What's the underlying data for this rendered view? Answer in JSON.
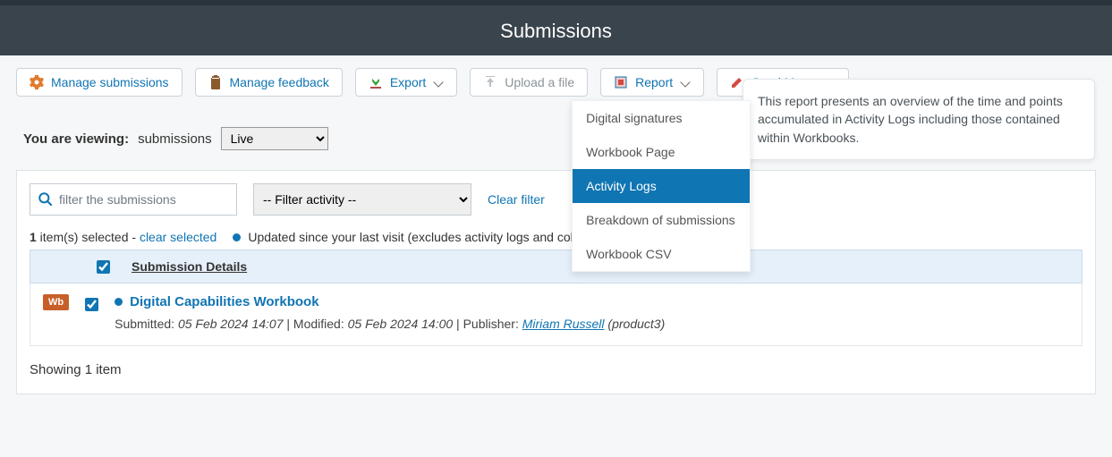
{
  "header": {
    "title": "Submissions"
  },
  "toolbar": {
    "manage_submissions": "Manage submissions",
    "manage_feedback": "Manage feedback",
    "export": "Export",
    "upload": "Upload a file",
    "report": "Report",
    "send_message": "Send Message"
  },
  "report_menu": {
    "digital_signatures": "Digital signatures",
    "workbook_page": "Workbook Page",
    "activity_logs": "Activity Logs",
    "breakdown": "Breakdown of submissions",
    "workbook_csv": "Workbook CSV"
  },
  "tooltip": {
    "text": "This report presents an overview of the time and points accumulated in Activity Logs including those contained within Workbooks."
  },
  "viewing": {
    "label": "You are viewing:",
    "noun": "submissions",
    "selected": "Live"
  },
  "filters": {
    "search_placeholder": "filter the submissions",
    "activity_placeholder": "-- Filter activity --",
    "clear": "Clear filter"
  },
  "status": {
    "count_text": "1",
    "selected_text": " item(s) selected - ",
    "clear_selected": "clear selected",
    "updated_text": "Updated since your last visit (excludes activity logs and collections)"
  },
  "table": {
    "header_col": "Submission Details"
  },
  "row": {
    "badge": "Wb",
    "title": "Digital Capabilities Workbook",
    "submitted_label": "Submitted: ",
    "submitted_val": "05 Feb 2024 14:07",
    "modified_label": "Modified: ",
    "modified_val": "05 Feb 2024 14:00",
    "publisher_label": "Publisher: ",
    "publisher_name": "Miriam Russell",
    "publisher_suffix": " (product3)"
  },
  "footer": {
    "showing": "Showing 1 item"
  }
}
